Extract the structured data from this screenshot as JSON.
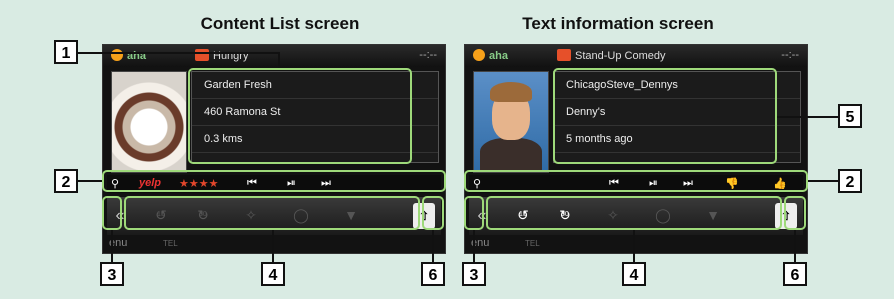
{
  "titles": {
    "left": "Content List screen",
    "right": "Text information screen"
  },
  "left_screen": {
    "status": {
      "source": "aha",
      "channel": "Hungry",
      "clock": "--:--"
    },
    "info": [
      "Garden Fresh",
      "460 Ramona St",
      "0.3 kms"
    ],
    "control_bar": {
      "search_icon": "search-icon",
      "logo": "yelp",
      "stars": "★★★★",
      "prev": "⏮",
      "play_pause": "⏯",
      "next": "⏭"
    },
    "shortcuts": {
      "collapse": "«",
      "rewind": "↺",
      "rewind_sec": "15",
      "forward": "↻",
      "forward_sec": "30",
      "more": "✧",
      "up": "⇧"
    },
    "footer": "enu",
    "footer_small": "TEL"
  },
  "right_screen": {
    "status": {
      "source": "aha",
      "channel": "Stand-Up Comedy",
      "clock": "--:--"
    },
    "info": [
      "ChicagoSteve_Dennys",
      "Denny's",
      "5 months ago"
    ],
    "control_bar": {
      "search_icon": "search-icon",
      "prev": "⏮",
      "play_pause": "⏯",
      "next": "⏭",
      "thumb_down": "👎",
      "thumb_up": "👍"
    },
    "shortcuts": {
      "collapse": "«",
      "rewind": "↺",
      "rewind_sec": "15",
      "forward": "↻",
      "forward_sec": "30",
      "more": "✧",
      "up": "⇧"
    },
    "footer": "enu",
    "footer_small": "TEL"
  },
  "callouts": [
    "1",
    "2",
    "2",
    "3",
    "3",
    "4",
    "4",
    "5",
    "6",
    "6"
  ],
  "colors": {
    "highlight": "#9ed97a",
    "background": "#d9ebe3"
  }
}
